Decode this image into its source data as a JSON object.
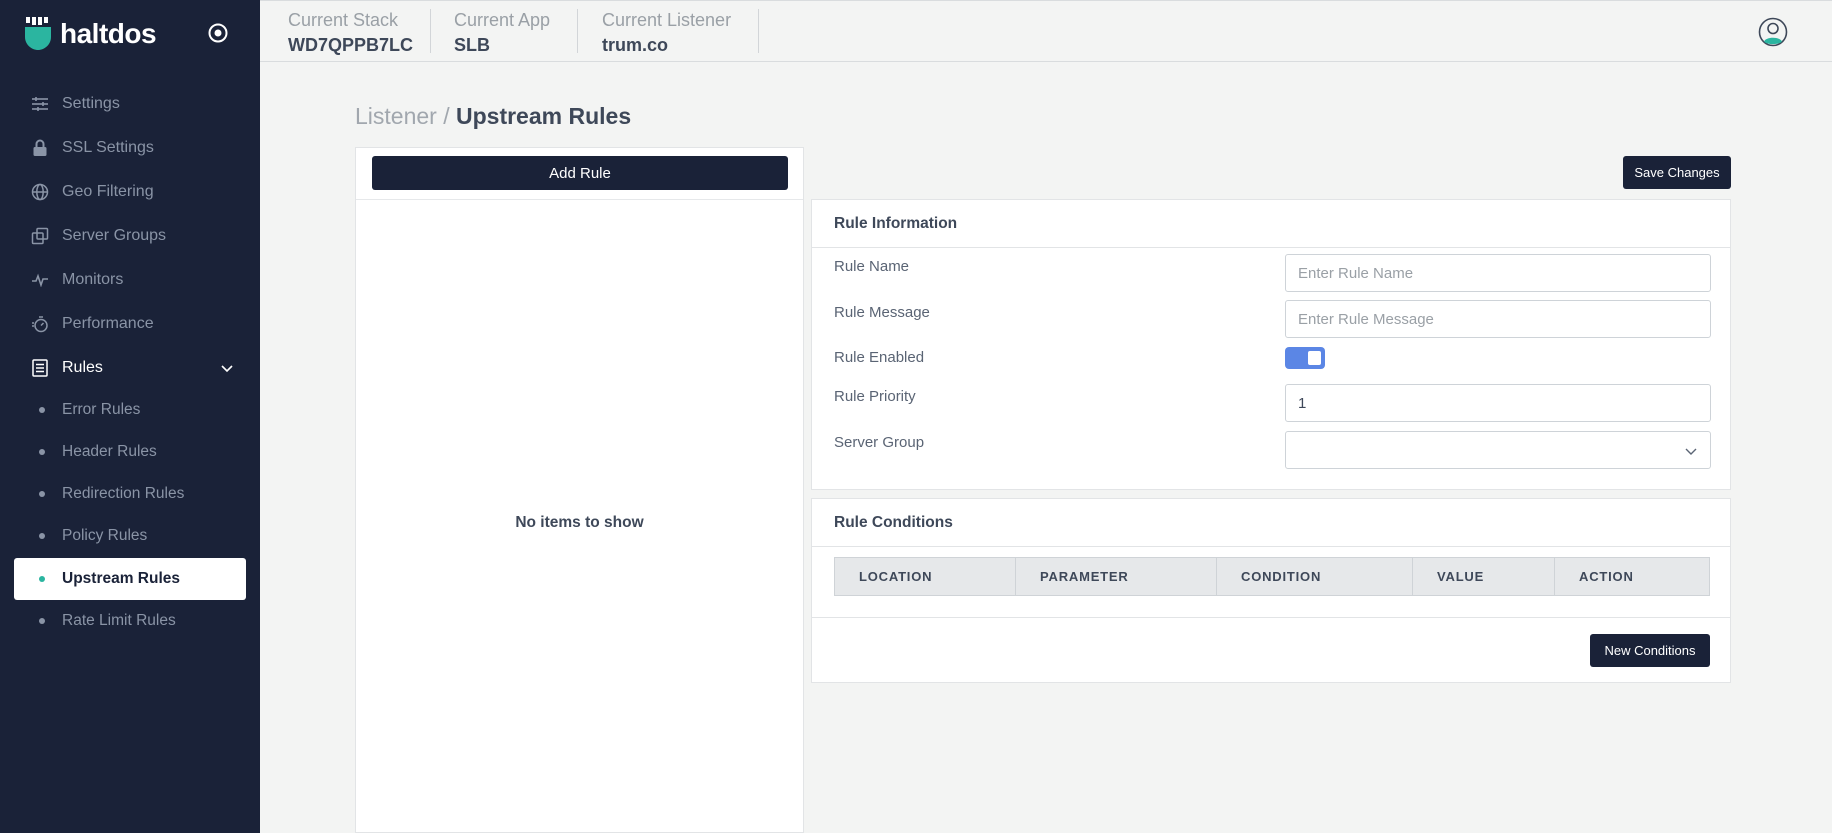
{
  "brand": {
    "name": "haltdos"
  },
  "topbar": {
    "stack": {
      "label": "Current Stack",
      "value": "WD7QPPB7LC"
    },
    "app": {
      "label": "Current App",
      "value": "SLB"
    },
    "listener": {
      "label": "Current Listener",
      "value": "trum.co"
    }
  },
  "sidebar": {
    "items": [
      {
        "label": "Settings",
        "icon": "sliders-icon"
      },
      {
        "label": "SSL Settings",
        "icon": "lock-icon"
      },
      {
        "label": "Geo Filtering",
        "icon": "globe-icon"
      },
      {
        "label": "Server Groups",
        "icon": "server-groups-icon"
      },
      {
        "label": "Monitors",
        "icon": "pulse-icon"
      },
      {
        "label": "Performance",
        "icon": "stopwatch-icon"
      },
      {
        "label": "Rules",
        "icon": "list-icon",
        "expanded": true
      }
    ],
    "sub_items": [
      {
        "label": "Error Rules"
      },
      {
        "label": "Header Rules"
      },
      {
        "label": "Redirection Rules"
      },
      {
        "label": "Policy Rules"
      },
      {
        "label": "Upstream Rules",
        "active": true
      },
      {
        "label": "Rate Limit Rules"
      }
    ]
  },
  "breadcrumb": {
    "parent": "Listener",
    "separator": " / ",
    "current": "Upstream Rules"
  },
  "list_panel": {
    "add_label": "Add Rule",
    "empty_text": "No items to show"
  },
  "actions": {
    "save_label": "Save Changes"
  },
  "rule_info": {
    "title": "Rule Information",
    "name_label": "Rule Name",
    "name_placeholder": "Enter Rule Name",
    "message_label": "Rule Message",
    "message_placeholder": "Enter Rule Message",
    "enabled_label": "Rule Enabled",
    "enabled": true,
    "priority_label": "Rule Priority",
    "priority_value": "1",
    "server_group_label": "Server Group",
    "server_group_value": ""
  },
  "conditions": {
    "title": "Rule Conditions",
    "columns": [
      "LOCATION",
      "PARAMETER",
      "CONDITION",
      "VALUE",
      "ACTION"
    ],
    "new_label": "New Conditions"
  },
  "colors": {
    "sidebar_bg": "#1a2238",
    "accent": "#2bb5a0",
    "toggle_on": "#5b86e5"
  }
}
